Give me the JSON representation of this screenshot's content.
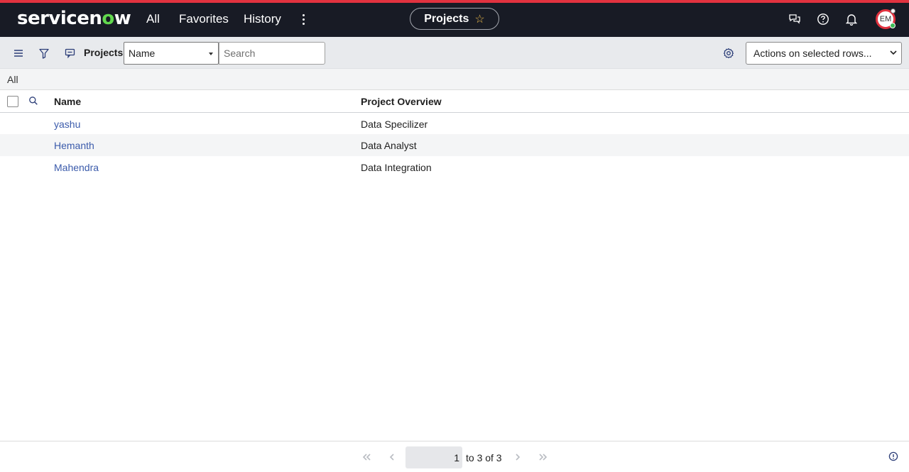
{
  "header": {
    "logo_text": "servicenow",
    "nav": [
      "All",
      "Favorites",
      "History"
    ],
    "context_title": "Projects",
    "avatar_initials": "EM",
    "brand_colors": {
      "bar": "#181b25",
      "accent": "#e1323f",
      "logo_o": "#62d84e"
    }
  },
  "toolbar": {
    "list_title": "Projects",
    "field_select": "Name",
    "search_placeholder": "Search",
    "actions_select": "Actions on selected rows..."
  },
  "breadcrumb": "All",
  "table": {
    "columns": [
      "Name",
      "Project Overview"
    ],
    "rows": [
      {
        "name": "yashu",
        "overview": "Data Specilizer"
      },
      {
        "name": "Hemanth",
        "overview": "Data Analyst"
      },
      {
        "name": "Mahendra",
        "overview": "Data Integration"
      }
    ]
  },
  "pagination": {
    "current": "1",
    "summary": "to 3 of 3"
  }
}
